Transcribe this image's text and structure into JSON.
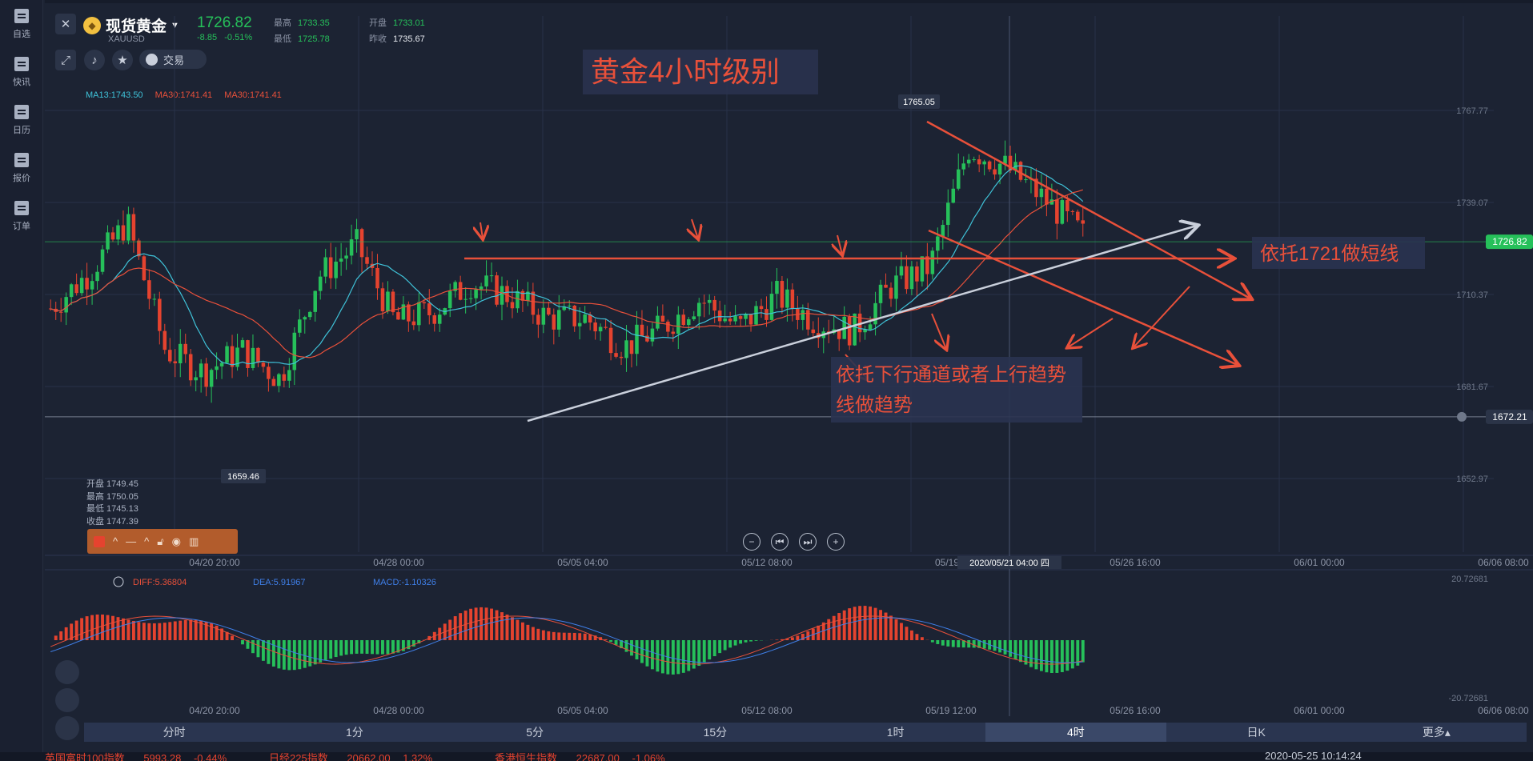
{
  "sidebar": {
    "items": [
      {
        "label": "自选",
        "icon": "star-bookmark-icon"
      },
      {
        "label": "快讯",
        "icon": "news-icon"
      },
      {
        "label": "日历",
        "icon": "calendar-icon"
      },
      {
        "label": "报价",
        "icon": "chart-line-icon"
      },
      {
        "label": "订单",
        "icon": "clipboard-icon"
      }
    ]
  },
  "header": {
    "symbol_name": "现货黄金",
    "symbol_code": "XAUUSD",
    "price": "1726.82",
    "change": "-8.85",
    "change_pct": "-0.51%",
    "high_label": "最高",
    "high": "1733.35",
    "open_label": "开盘",
    "open": "1733.01",
    "low_label": "最低",
    "low": "1725.78",
    "prev_close_label": "昨收",
    "prev_close": "1735.67",
    "trade_label": "交易",
    "colors": {
      "up": "#26c05a",
      "down": "#e5432f"
    }
  },
  "chart_title": "黄金4小时级别",
  "ma_legend": [
    {
      "text": "MA13:1743.50",
      "color": "#3fc2d8"
    },
    {
      "text": "MA30:1741.41",
      "color": "#e8503a"
    },
    {
      "text": "MA30:1741.41",
      "color": "#e8503a"
    }
  ],
  "ohlc": [
    "开盘 1749.45",
    "最高 1750.05",
    "最低 1745.13",
    "收盘 1747.39"
  ],
  "annotations": {
    "short_line": "依托1721做短线",
    "trend_line_1": "依托下行通道或者上行趋势",
    "trend_line_2": "线做趋势",
    "peak_label": "1765.05",
    "trough_label": "1659.46",
    "crosshair_date": "2020/05/21 04:00 四"
  },
  "chart_data": {
    "type": "line",
    "price_axis": [
      "1767.77",
      "1739.07",
      "1710.37",
      "1681.67",
      "1652.97"
    ],
    "current_price": "1726.82",
    "alert_price": "1672.21",
    "x_labels": [
      "04/20 20:00",
      "04/28 00:00",
      "05/05 04:00",
      "05/12 08:00",
      "05/19 1",
      "05/26 16:00",
      "06/01 00:00",
      "06/06 08:00"
    ],
    "price_series": {
      "x": [
        "04/14",
        "04/15",
        "04/16",
        "04/17",
        "04/20",
        "04/21",
        "04/22",
        "04/23",
        "04/24",
        "04/27",
        "04/28",
        "04/29",
        "04/30",
        "05/01",
        "05/04",
        "05/05",
        "05/06",
        "05/07",
        "05/08",
        "05/11",
        "05/12",
        "05/13",
        "05/14",
        "05/15",
        "05/18",
        "05/19",
        "05/20",
        "05/21"
      ],
      "close": [
        1706,
        1717,
        1733,
        1693,
        1686,
        1693,
        1684,
        1716,
        1726,
        1702,
        1705,
        1714,
        1710,
        1703,
        1703,
        1694,
        1700,
        1709,
        1700,
        1710,
        1702,
        1699,
        1713,
        1719,
        1756,
        1750,
        1740,
        1729
      ]
    },
    "macd": {
      "legend": [
        "DIFF:5.36804",
        "DEA:5.91967",
        "MACD:-1.10326"
      ],
      "colors": [
        "#e8503a",
        "#3f7fe8",
        "#3f7fe8"
      ],
      "axis": [
        "20.72681",
        "-20.72681"
      ],
      "x_labels": [
        "04/20 20:00",
        "04/28 00:00",
        "05/05 04:00",
        "05/12 08:00",
        "05/19 12:00",
        "05/26 16:00",
        "06/01 00:00",
        "06/06 08:00"
      ]
    }
  },
  "timeframes": [
    {
      "label": "分时",
      "active": false
    },
    {
      "label": "1分",
      "active": false
    },
    {
      "label": "5分",
      "active": false
    },
    {
      "label": "15分",
      "active": false
    },
    {
      "label": "1时",
      "active": false
    },
    {
      "label": "4时",
      "active": true
    },
    {
      "label": "日K",
      "active": false
    },
    {
      "label": "更多▴",
      "active": false
    }
  ],
  "ticker": [
    {
      "name": "英国富时100指数",
      "value": "5993.28",
      "chg": "-0.44%"
    },
    {
      "name": "日经225指数",
      "value": "20662.00",
      "chg": "1.32%"
    },
    {
      "name": "香港恒生指数",
      "value": "22687.00",
      "chg": "-1.06%"
    }
  ],
  "status_time": "2020-05-25 10:14:24"
}
